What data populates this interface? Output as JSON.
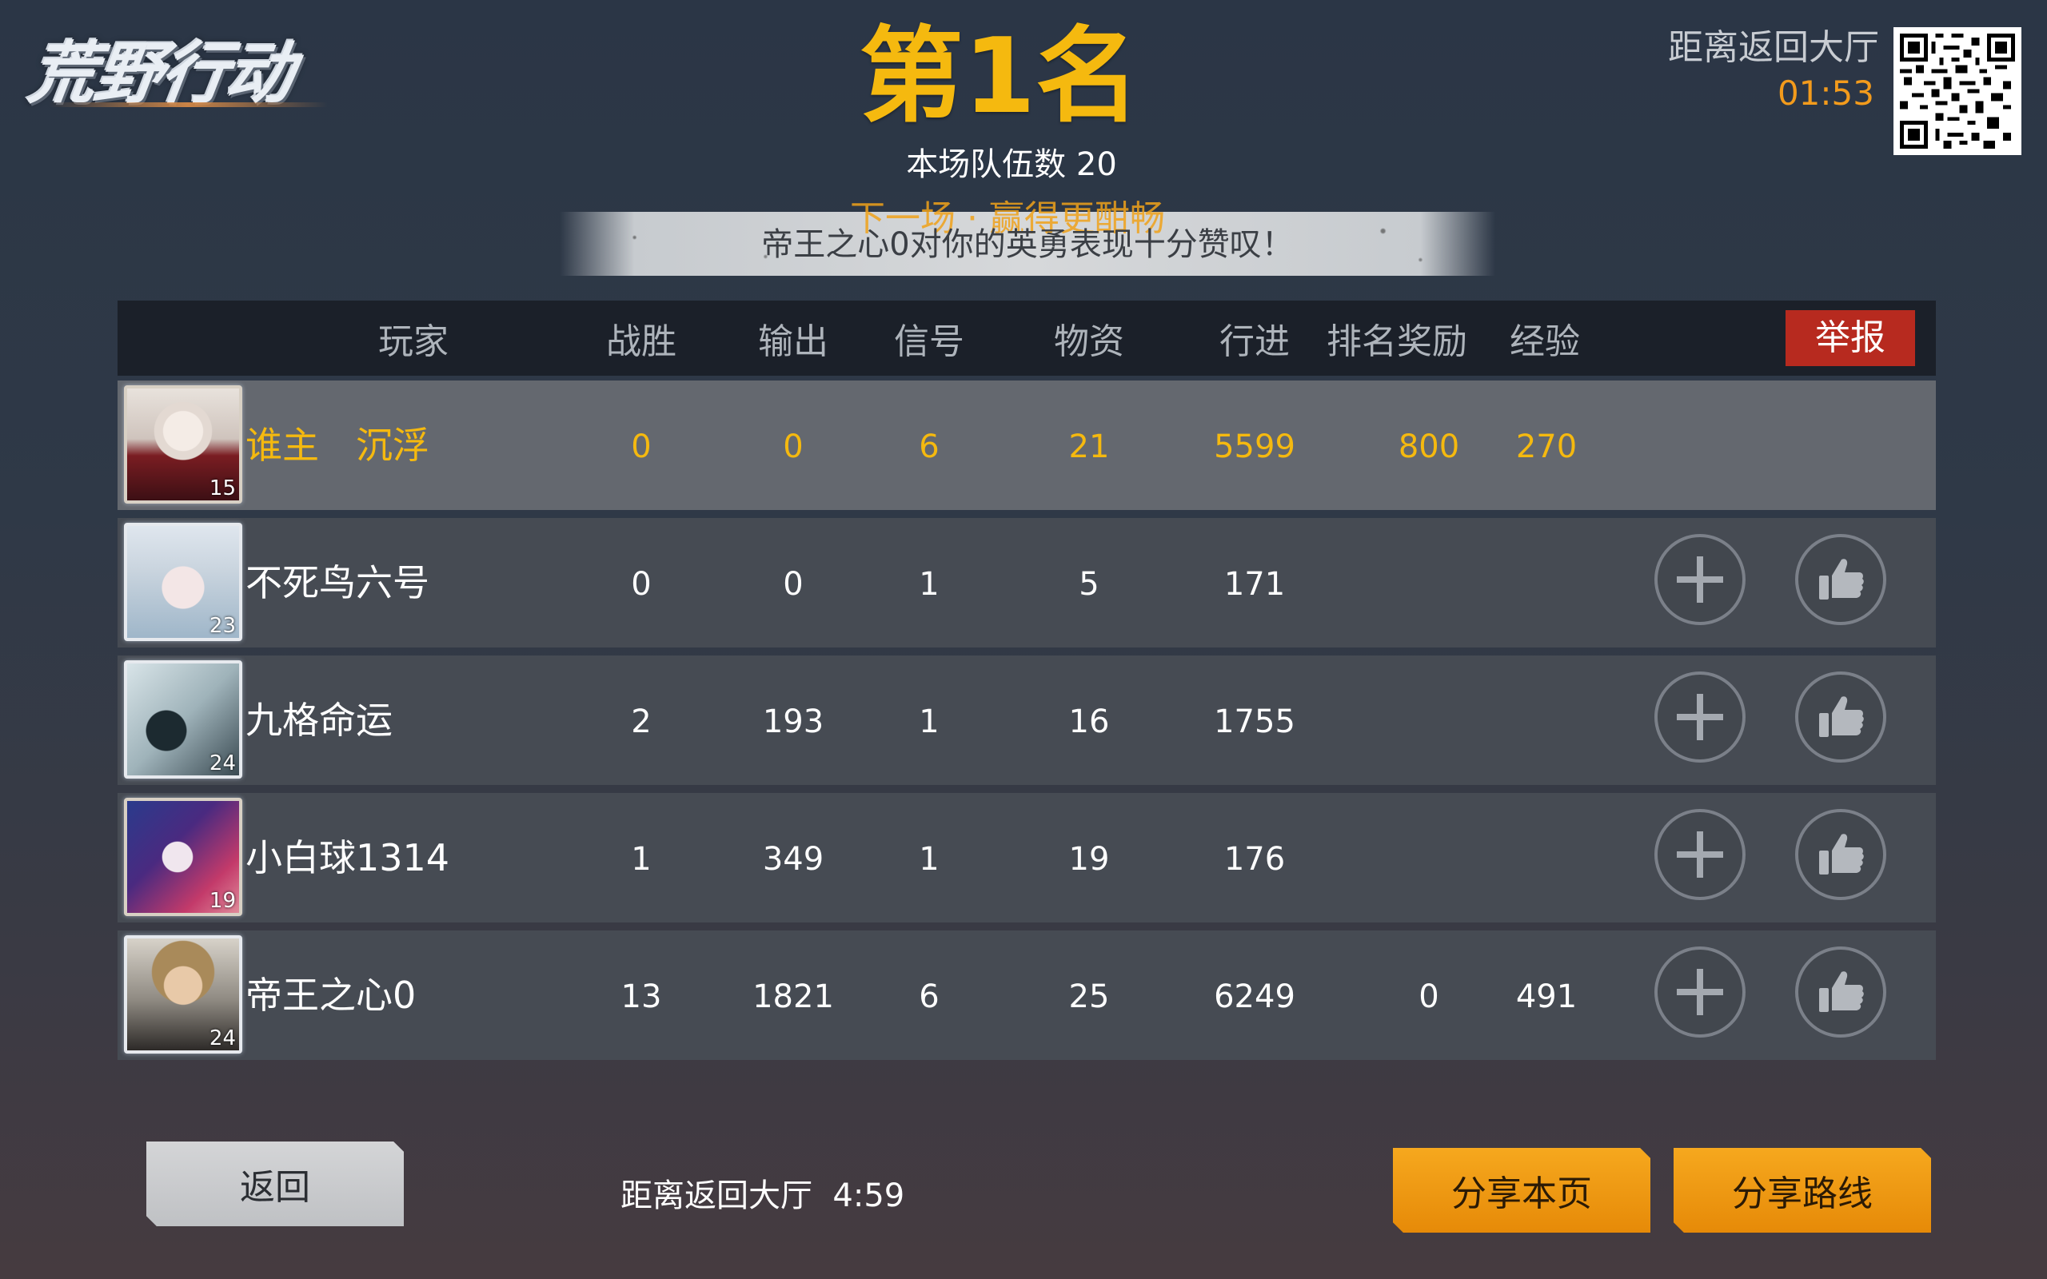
{
  "logo": {
    "text": "荒野行动"
  },
  "result": {
    "rank_title": "第1名",
    "team_count_text": "本场队伍数 20"
  },
  "banner": {
    "next_text": "下一场 · 赢得更酣畅",
    "praise_text": "帝王之心0对你的英勇表现十分赞叹！"
  },
  "timer": {
    "label": "距离返回大厅",
    "value": "01:53"
  },
  "qr": {
    "icon": "qr-code-icon"
  },
  "table": {
    "columns": [
      "玩家",
      "战胜",
      "输出",
      "信号",
      "物资",
      "行进",
      "排名奖励",
      "经验"
    ],
    "report_label": "举报",
    "rows": [
      {
        "name": "谁主　沉浮",
        "level": "15",
        "wins": "0",
        "damage": "0",
        "signal": "6",
        "supplies": "21",
        "travel": "5599",
        "rank_reward": "800",
        "exp": "270",
        "self": true
      },
      {
        "name": "不死鸟六号",
        "level": "23",
        "wins": "0",
        "damage": "0",
        "signal": "1",
        "supplies": "5",
        "travel": "171",
        "rank_reward": "",
        "exp": "",
        "self": false
      },
      {
        "name": "九格命运",
        "level": "24",
        "wins": "2",
        "damage": "193",
        "signal": "1",
        "supplies": "16",
        "travel": "1755",
        "rank_reward": "",
        "exp": "",
        "self": false
      },
      {
        "name": "小白球1314",
        "level": "19",
        "wins": "1",
        "damage": "349",
        "signal": "1",
        "supplies": "19",
        "travel": "176",
        "rank_reward": "",
        "exp": "",
        "self": false
      },
      {
        "name": "帝王之心0",
        "level": "24",
        "wins": "13",
        "damage": "1821",
        "signal": "6",
        "supplies": "25",
        "travel": "6249",
        "rank_reward": "0",
        "exp": "491",
        "self": false
      }
    ],
    "add_friend_icon": "plus-icon",
    "like_icon": "thumbs-up-icon"
  },
  "footer": {
    "back_label": "返回",
    "lobby_countdown_text": "距离返回大厅  4:59",
    "share_page_label": "分享本页",
    "share_route_label": "分享路线"
  },
  "colors": {
    "accent_gold": "#f5b90f",
    "timer_orange": "#f39b1c",
    "report_red": "#b72a1f",
    "share_orange": "#f0990f"
  }
}
